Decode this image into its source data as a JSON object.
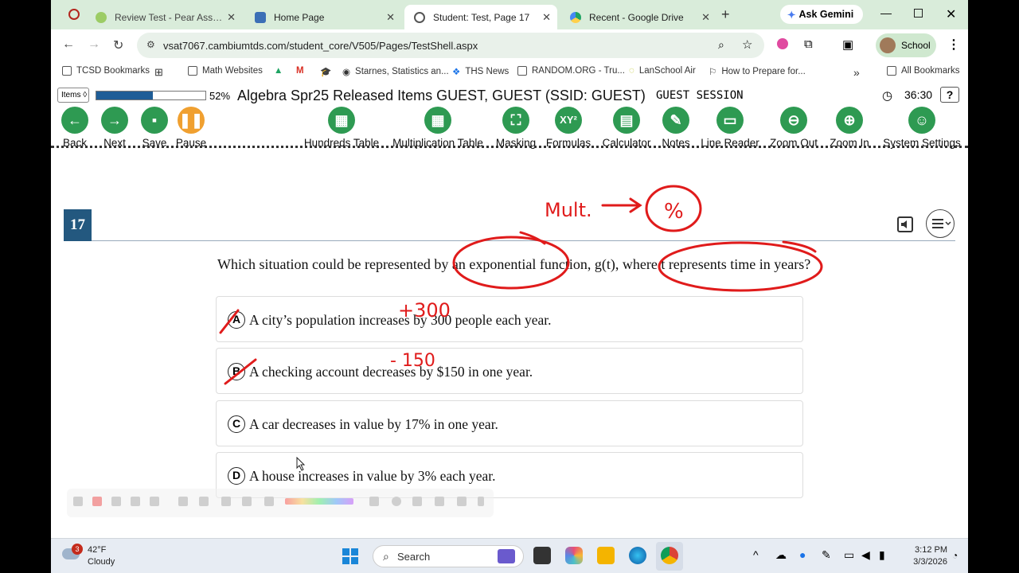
{
  "browser": {
    "tabs": [
      {
        "label": "Review Test - Pear Assessment",
        "active": false
      },
      {
        "label": "Home Page",
        "active": false
      },
      {
        "label": "Student: Test, Page 17",
        "active": true
      },
      {
        "label": "Recent - Google Drive",
        "active": false
      }
    ],
    "ask_gemini": "Ask Gemini",
    "url": "vsat7067.cambiumtds.com/student_core/V505/Pages/TestShell.aspx",
    "profile_label": "School",
    "bookmarks": [
      "TCSD Bookmarks",
      "Math Websites",
      "Starnes, Statistics an...",
      "THS News",
      "RANDOM.ORG - Tru...",
      "LanSchool Air",
      "How to Prepare for..."
    ],
    "all_bookmarks": "All Bookmarks"
  },
  "test": {
    "items_label": "Items",
    "progress_percent": 52,
    "progress_text": "52%",
    "title": "Algebra Spr25 Released Items   GUEST, GUEST (SSID: GUEST)",
    "session": "GUEST SESSION",
    "timer": "36:30",
    "help": "?"
  },
  "tools": [
    "Back",
    "Next",
    "Save",
    "Pause",
    "Hundreds Table",
    "Multiplication Table",
    "Masking",
    "Formulas",
    "Calculator",
    "Notes",
    "Line Reader",
    "Zoom Out",
    "Zoom In",
    "System Settings"
  ],
  "question": {
    "number": "17",
    "stem": "Which situation could be represented by an exponential function, g(t), where t represents time in years?",
    "options": [
      {
        "letter": "A",
        "text": "A city’s population increases by 300 people each year."
      },
      {
        "letter": "B",
        "text": "A checking account decreases by $150 in one year."
      },
      {
        "letter": "C",
        "text": "A car decreases in value by 17% in one year."
      },
      {
        "letter": "D",
        "text": "A house increases in value by 3% each year."
      }
    ]
  },
  "annotations": {
    "mult": "Mult.",
    "percent": "%",
    "plus300": "+300",
    "minus150": "- 150"
  },
  "taskbar": {
    "temperature": "42°F",
    "condition": "Cloudy",
    "notification_count": "3",
    "search": "Search",
    "time": "3:12 PM",
    "date": "3/3/2026"
  }
}
